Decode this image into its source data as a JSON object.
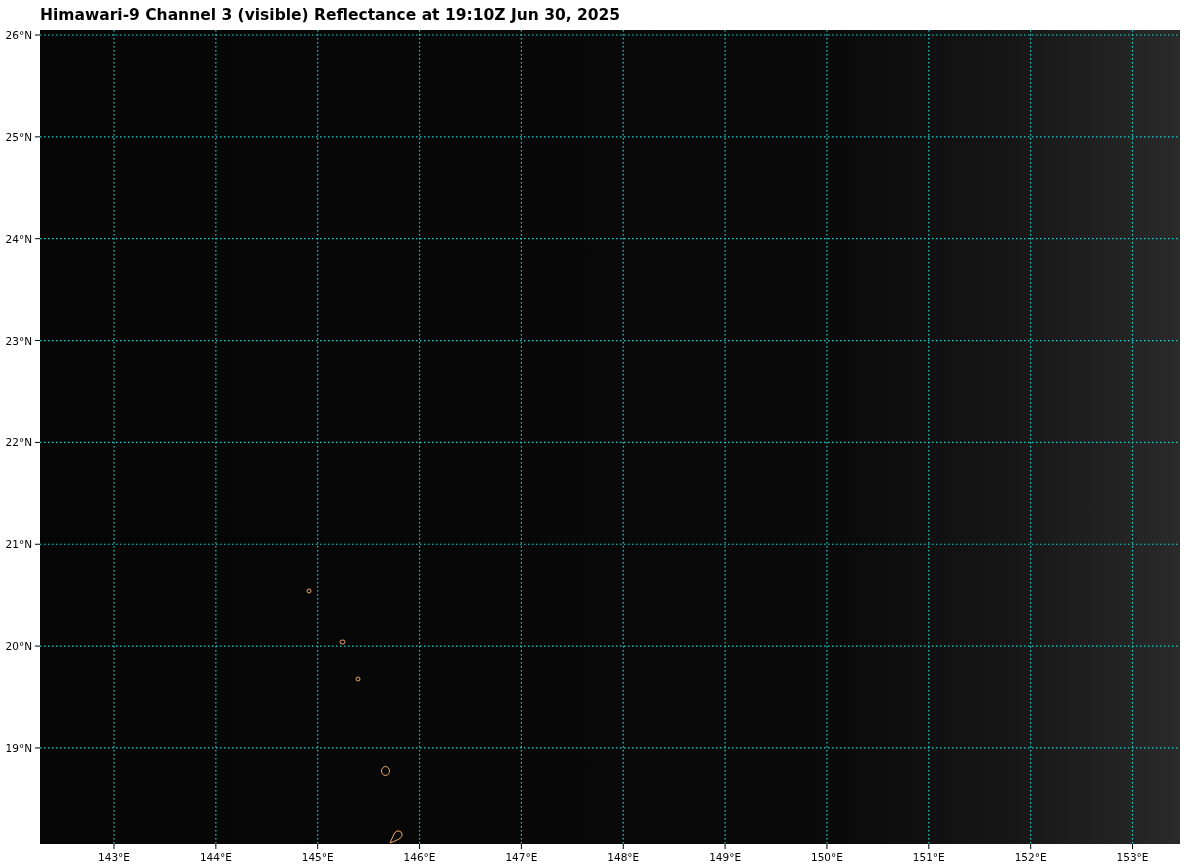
{
  "title": "Himawari-9 Channel 3 (visible) Reflectance at 19:10Z Jun 30, 2025",
  "map": {
    "lat_labels": [
      "26°N",
      "25°N",
      "24°N",
      "23°N",
      "22°N",
      "21°N",
      "20°N",
      "19°N"
    ],
    "lon_labels": [
      "143°E",
      "144°E",
      "145°E",
      "146°E",
      "147°E",
      "148°E",
      "149°E",
      "150°E",
      "151°E",
      "152°E",
      "153°E"
    ]
  }
}
